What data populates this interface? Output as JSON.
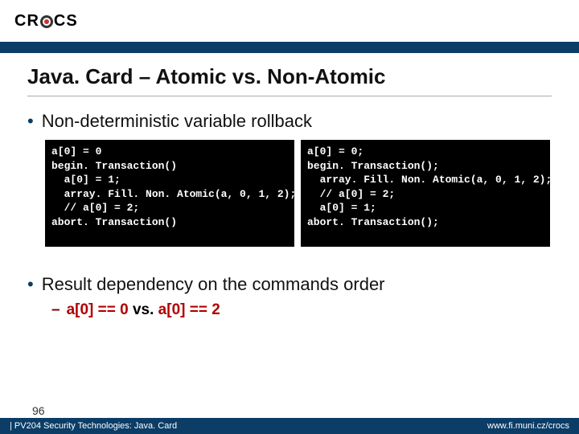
{
  "logo": {
    "pre": "CR",
    "post": "CS"
  },
  "title": "Java. Card – Atomic vs. Non-Atomic",
  "bullet1": "Non-deterministic variable rollback",
  "code_left": "a[0] = 0\nbegin. Transaction()\n  a[0] = 1;\n  array. Fill. Non. Atomic(a, 0, 1, 2);\n  // a[0] = 2;\nabort. Transaction()",
  "code_right": "a[0] = 0;\nbegin. Transaction();\n  array. Fill. Non. Atomic(a, 0, 1, 2);\n  // a[0] = 2;\n  a[0] = 1;\nabort. Transaction();",
  "bullet2": "Result dependency on the commands order",
  "sub": {
    "a": "a[0] == 0",
    "vs": " vs. ",
    "b": "a[0] == 2"
  },
  "page": "96",
  "footer_left": " | PV204 Security Technologies: Java. Card",
  "footer_right": "www.fi.muni.cz/crocs"
}
